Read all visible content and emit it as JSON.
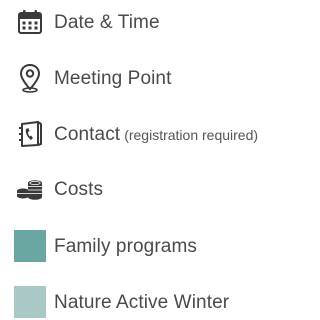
{
  "legend": {
    "items": [
      {
        "label": "Date & Time",
        "icon": "calendar-icon"
      },
      {
        "label": "Meeting Point",
        "icon": "location-pin-icon"
      },
      {
        "label": "Contact",
        "note": "(registration required)",
        "icon": "contact-phone-icon"
      },
      {
        "label": "Costs",
        "icon": "coins-icon"
      },
      {
        "label": "Family programs",
        "color": "#6aa6a2"
      },
      {
        "label": "Nature Active Winter",
        "color": "#a9c8c6"
      }
    ]
  }
}
